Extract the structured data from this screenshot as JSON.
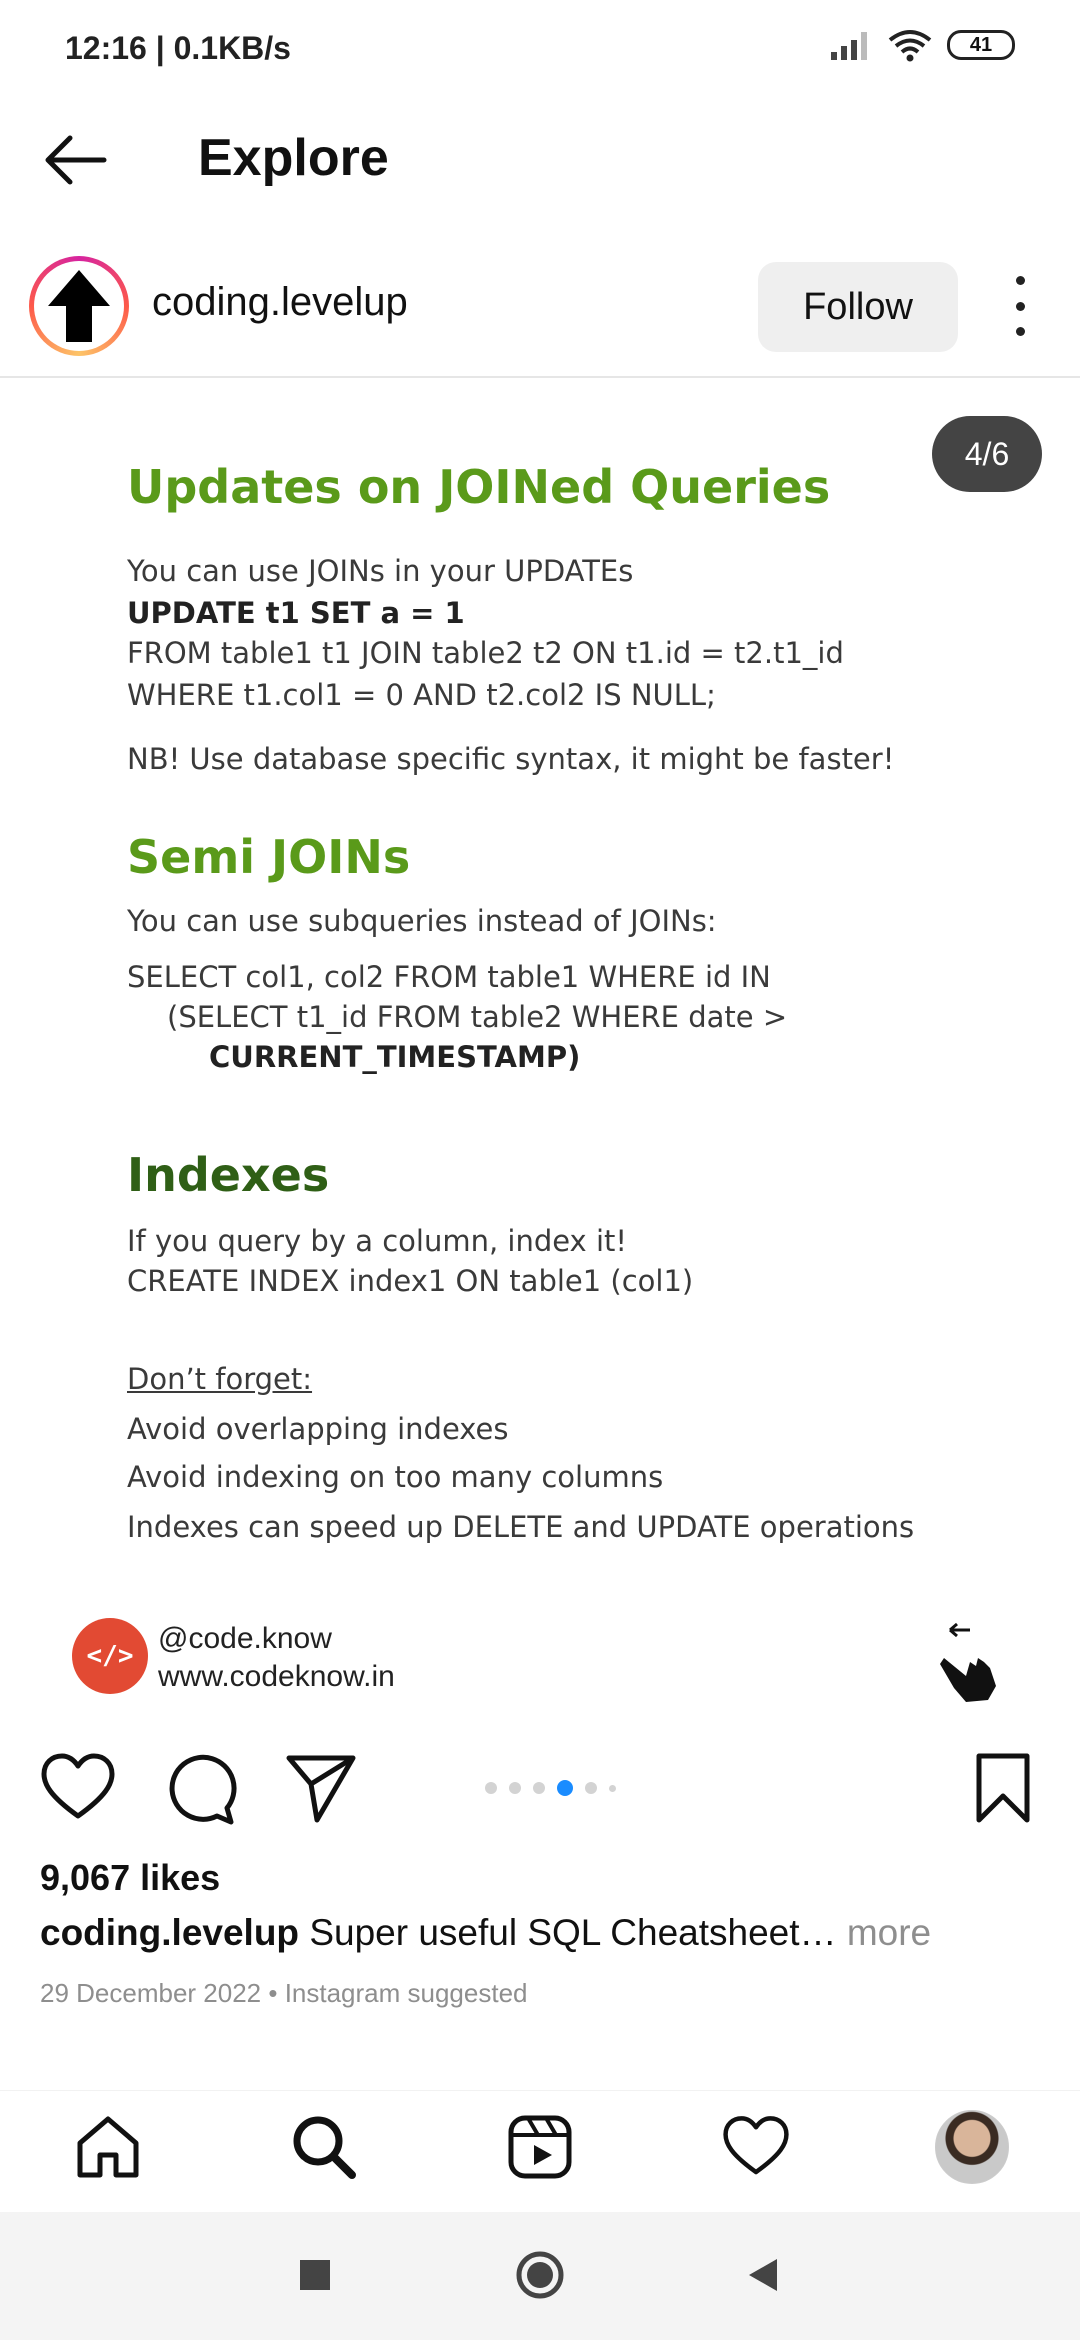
{
  "status_bar": {
    "time": "12:16 | 0.1KB/s",
    "battery": "41",
    "icons": [
      "signal-icon",
      "wifi-icon",
      "battery-icon"
    ]
  },
  "header": {
    "title": "Explore",
    "back_icon": "back-arrow-icon"
  },
  "post": {
    "username": "coding.levelup",
    "follow_label": "Follow",
    "counter": "4/6",
    "slide": {
      "section1_title": "Updates on JOINed Queries",
      "section1_lines": [
        "You can use JOINs in your UPDATEs",
        "UPDATE t1 SET a = 1",
        "FROM table1 t1 JOIN table2 t2 ON t1.id = t2.t1_id",
        "WHERE t1.col1 = 0 AND t2.col2 IS NULL;",
        "NB! Use database specific syntax, it might be faster!"
      ],
      "section2_title": "Semi JOINs",
      "section2_lines": [
        "You can use subqueries instead of JOINs:",
        "SELECT col1, col2 FROM table1 WHERE id IN",
        "(SELECT t1_id FROM table2 WHERE date >",
        "CURRENT_TIMESTAMP)"
      ],
      "section3_title": "Indexes",
      "section3_lines": [
        "If you query by a column, index it!",
        "CREATE INDEX index1 ON table1 (col1)",
        "Don’t forget:",
        "Avoid overlapping indexes",
        "Avoid indexing on too many columns",
        "Indexes can speed up DELETE and UPDATE operations"
      ],
      "brand_logo_text": "</>",
      "brand_handle": "@code.know",
      "brand_url": "www.codeknow.in"
    },
    "likes": "9,067 likes",
    "caption_user": "coding.levelup",
    "caption_text": "Super useful SQL Cheatsheet…",
    "caption_more": "more",
    "meta": "29 December 2022 • Instagram suggested",
    "carousel": {
      "count": 6,
      "active_index": 3
    }
  },
  "bottom_nav": {
    "items": [
      "home-icon",
      "search-icon",
      "reels-icon",
      "activity-heart-icon",
      "profile-avatar"
    ]
  },
  "colors": {
    "accent_blue": "#1a8cff",
    "green_heading": "#5a9a1a",
    "dark_green_heading": "#2f5f16",
    "follow_bg": "#efefef",
    "counter_bg": "#444444"
  }
}
